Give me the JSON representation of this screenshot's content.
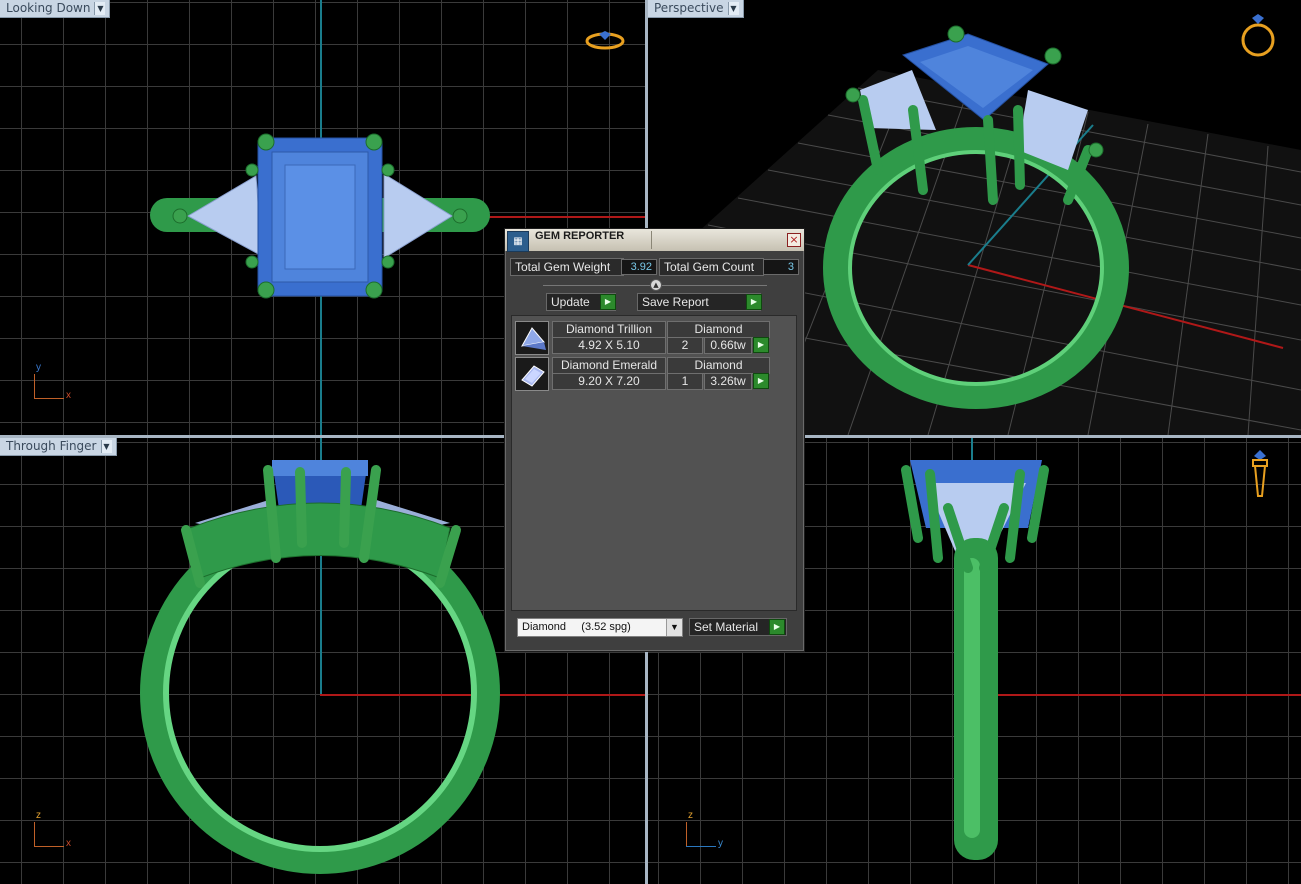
{
  "viewports": {
    "top_left": {
      "label": "Looking Down",
      "axes": [
        "y",
        "x"
      ]
    },
    "top_right": {
      "label": "Perspective"
    },
    "bottom_left": {
      "label": "Through Finger",
      "axes": [
        "z",
        "x"
      ]
    },
    "bottom_right": {
      "axes": [
        "z",
        "y"
      ]
    }
  },
  "dialog": {
    "title": "GEM REPORTER",
    "total_weight_label": "Total Gem Weight",
    "total_weight_value": "3.92",
    "total_count_label": "Total Gem Count",
    "total_count_value": "3",
    "update_label": "Update",
    "save_report_label": "Save Report",
    "gems": [
      {
        "name": "Diamond Trillion",
        "material": "Diamond",
        "size": "4.92 X 5.10",
        "count": "2",
        "weight": "0.66tw"
      },
      {
        "name": "Diamond Emerald",
        "material": "Diamond",
        "size": "9.20 X 7.20",
        "count": "1",
        "weight": "3.26tw"
      }
    ],
    "material_select": "Diamond     (3.52 spg)",
    "set_material_label": "Set Material"
  },
  "colors": {
    "metal": "#2f9a4a",
    "metal_light": "#5fd07a",
    "gem_center": "#3a6fcf",
    "gem_side": "#b8ccf0",
    "axis_red": "#b01818",
    "axis_teal": "#1a7d8c"
  }
}
